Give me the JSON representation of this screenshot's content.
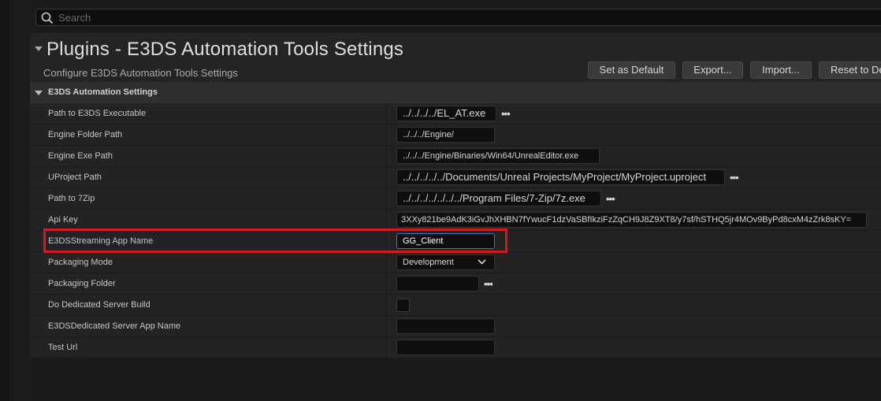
{
  "search": {
    "placeholder": "Search"
  },
  "header": {
    "title": "Plugins - E3DS Automation Tools Settings",
    "subtitle": "Configure E3DS Automation Tools Settings",
    "buttons": {
      "set_default": "Set as Default",
      "export": "Export...",
      "import": "Import...",
      "reset": "Reset to Defaults"
    }
  },
  "section": {
    "title": "E3DS Automation Settings"
  },
  "settings": {
    "path_e3ds": {
      "label": "Path to E3DS Executable",
      "value": "../../../../EL_AT.exe"
    },
    "engine_folder": {
      "label": "Engine Folder Path",
      "value": "../../../Engine/"
    },
    "engine_exe": {
      "label": "Engine Exe Path",
      "value": "../../../Engine/Binaries/Win64/UnrealEditor.exe"
    },
    "uproject": {
      "label": "UProject Path",
      "value": "../../../../../Documents/Unreal Projects/MyProject/MyProject.uproject"
    },
    "zip": {
      "label": "Path to 7Zip",
      "value": "../../../../../../../Program Files/7-Zip/7z.exe"
    },
    "api_key": {
      "label": "Api Key",
      "value": "3XXy821be9AdK3iGvJhXHBN7fYwucF1dzVaSBfIkziFzZqCH9J8Z9XT8/y7sf/hSTHQ5jr4MOv9ByPd8cxM4zZrk8sKY="
    },
    "app_name": {
      "label": "E3DSStreaming App Name",
      "value": "GG_Client"
    },
    "packaging_mode": {
      "label": "Packaging Mode",
      "value": "Development"
    },
    "packaging_folder": {
      "label": "Packaging Folder",
      "value": ""
    },
    "dedicated_build": {
      "label": "Do Dedicated Server Build",
      "checked": false
    },
    "dedicated_app": {
      "label": "E3DSDedicated Server App Name",
      "value": ""
    },
    "test_url": {
      "label": "Test Url",
      "value": ""
    }
  },
  "colors": {
    "highlight": "#d01c1c",
    "focus": "#2a7fd4"
  }
}
